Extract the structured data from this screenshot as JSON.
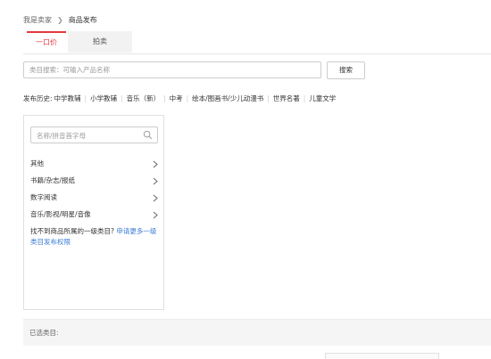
{
  "breadcrumb": {
    "home": "我是卖家",
    "separator": "❯",
    "current": "商品发布"
  },
  "tabs": [
    {
      "label": "一口价"
    },
    {
      "label": "拍卖"
    }
  ],
  "search": {
    "placeholder": "类目搜索：可输入产品名称",
    "button_label": "搜索"
  },
  "history": {
    "label": "发布历史:",
    "items": [
      "中学教辅",
      "小学教辅",
      "音乐（新）",
      "中考",
      "绘本/图画书/少儿动漫书",
      "世界名著",
      "儿童文学"
    ]
  },
  "category_panel": {
    "search_placeholder": "名称/拼音首字母",
    "items": [
      "其他",
      "书籍/杂志/报纸",
      "数字阅读",
      "音乐/影视/明星/音像"
    ],
    "not_found_text": "找不到商品所属的一级类目?",
    "not_found_link": "申请更多一级类目发布权限"
  },
  "selected": {
    "label": "已选类目:"
  },
  "colors": {
    "accent": "#e4393c",
    "link": "#3a7bd5"
  }
}
